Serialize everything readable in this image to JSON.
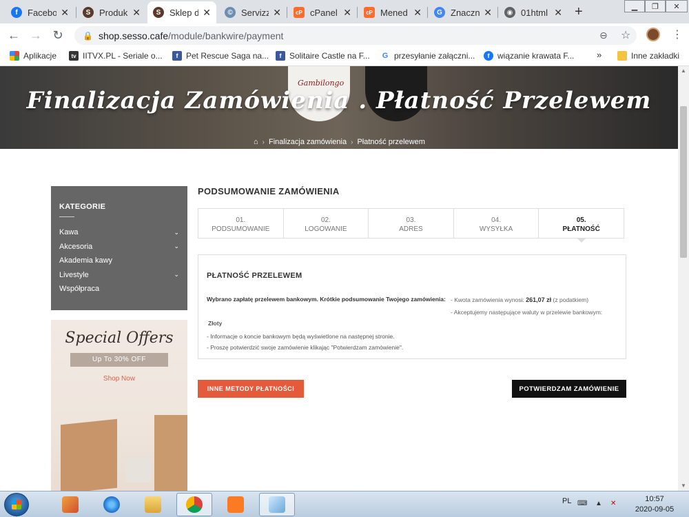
{
  "browser": {
    "tabs": [
      {
        "label": "Facebo",
        "favicon": "facebook-icon",
        "color": "#1877f2",
        "glyph": "f"
      },
      {
        "label": "Produk",
        "favicon": "sesso-icon",
        "color": "#5a3a2a",
        "glyph": "S"
      },
      {
        "label": "Sklep d",
        "favicon": "sesso-icon",
        "color": "#5a3a2a",
        "glyph": "S",
        "active": true
      },
      {
        "label": "Servizz",
        "favicon": "servizz-icon",
        "color": "#6b8fb0",
        "glyph": "©"
      },
      {
        "label": "cPanel",
        "favicon": "cpanel-icon",
        "color": "#ff6c2c",
        "glyph": "cP"
      },
      {
        "label": "Mened",
        "favicon": "cpanel-icon",
        "color": "#ff6c2c",
        "glyph": "cP"
      },
      {
        "label": "Znaczn",
        "favicon": "google-icon",
        "color": "#4285f4",
        "glyph": "G"
      },
      {
        "label": "01html",
        "favicon": "globe-icon",
        "color": "#5f6368",
        "glyph": "◉"
      }
    ],
    "new_tab": "+",
    "url_host": "shop.sesso.cafe",
    "url_path": "/module/bankwire/payment",
    "bookmarks": [
      {
        "label": "Aplikacje",
        "icon": "apps-icon",
        "color": "#ea4335",
        "glyph": "⋮"
      },
      {
        "label": "IITVX.PL - Seriale o...",
        "icon": "itvx-icon",
        "color": "#333333",
        "glyph": "tv"
      },
      {
        "label": "Pet Rescue Saga na...",
        "icon": "facebook-icon",
        "color": "#3b5998",
        "glyph": "f"
      },
      {
        "label": "Solitaire Castle na F...",
        "icon": "facebook-icon",
        "color": "#3b5998",
        "glyph": "f"
      },
      {
        "label": "przesyłanie załączni...",
        "icon": "google-icon",
        "color": "#4285f4",
        "glyph": "G"
      },
      {
        "label": "wiązanie krawata  F...",
        "icon": "facebook-icon",
        "color": "#1877f2",
        "glyph": "f"
      }
    ],
    "bookmarks_more": "»",
    "other_bookmarks": "Inne zakładki"
  },
  "page": {
    "hero_title": "Finalizacja Zamówienia . Płatność Przelewem",
    "hero_logo": "Gambilongo",
    "breadcrumb": [
      "Finalizacja zamówienia",
      "Płatność przelewem"
    ],
    "sidebar": {
      "title": "KATEGORIE",
      "items": [
        {
          "label": "Kawa",
          "has_children": true
        },
        {
          "label": "Akcesoria",
          "has_children": true
        },
        {
          "label": "Akademia kawy",
          "has_children": false
        },
        {
          "label": "Livestyle",
          "has_children": true
        },
        {
          "label": "Współpraca",
          "has_children": false
        }
      ],
      "promo_title": "Special Offers",
      "promo_sub": "Up To 30% OFF",
      "promo_link": "Shop Now"
    },
    "summary_title": "PODSUMOWANIE ZAMÓWIENIA",
    "steps": [
      {
        "num": "01.",
        "label": "PODSUMOWANIE"
      },
      {
        "num": "02.",
        "label": "LOGOWANIE"
      },
      {
        "num": "03.",
        "label": "ADRES"
      },
      {
        "num": "04.",
        "label": "WYSYŁKA"
      },
      {
        "num": "05.",
        "label": "PŁATNOŚĆ",
        "current": true
      }
    ],
    "payment": {
      "title": "PŁATNOŚĆ PRZELEWEM",
      "chosen": "Wybrano zapłatę przelewem bankowym. Krótkie podsumowanie Twojego zamówienia:",
      "amount_prefix": "- Kwota zamówienia wynosi:",
      "amount": "261,07 zł",
      "amount_suffix": "(z podatkiem)",
      "currency_note": "- Akceptujemy następujące waluty w przelewie bankowym:",
      "currency": "Złoty",
      "info": [
        "- Informacje o koncie bankowym będą wyświetlone na następnej stronie.",
        "- Proszę potwierdzić swoje zamówienie klikając \"Potwierdzam zamówienie\"."
      ]
    },
    "btn_other": "INNE METODY PŁATNOŚCI",
    "btn_confirm": "POTWIERDZAM ZAMÓWIENIE"
  },
  "taskbar": {
    "lang": "PL",
    "time": "10:57",
    "date": "2020-09-05"
  },
  "colors": {
    "accent_orange": "#e55a3b",
    "confirm_black": "#111111",
    "sidebar_gray": "#666666"
  }
}
